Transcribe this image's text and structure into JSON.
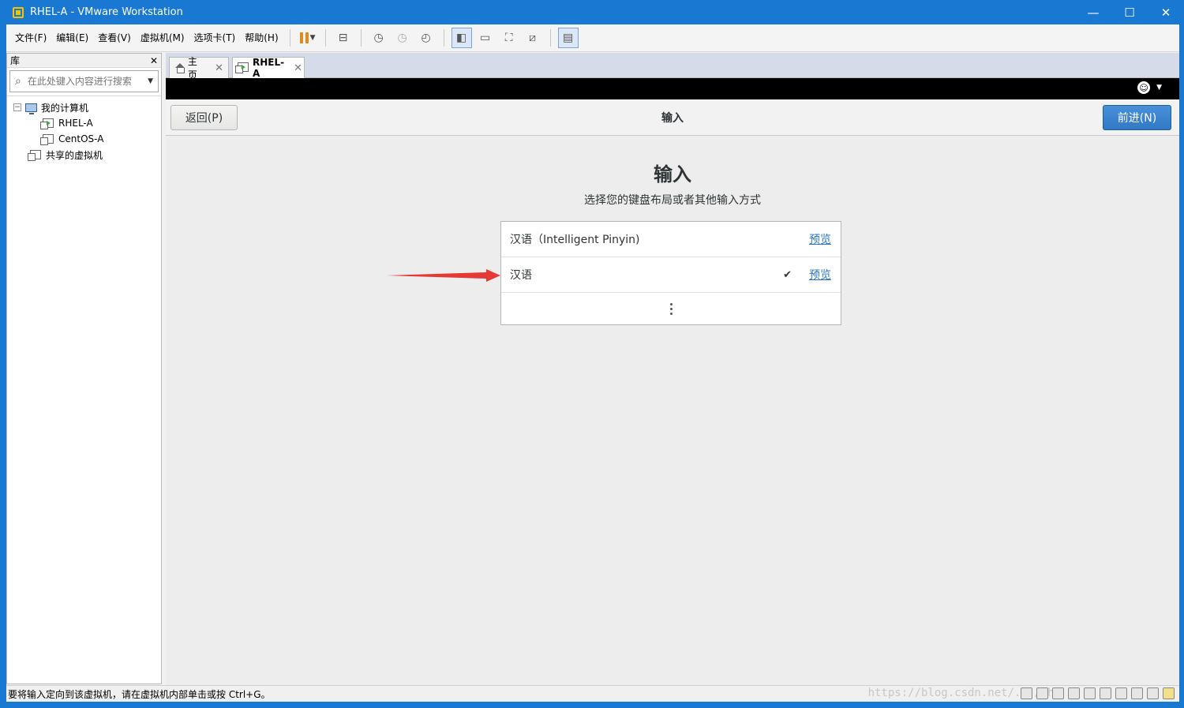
{
  "window": {
    "title": "RHEL-A - VMware Workstation",
    "minimize": "—",
    "maximize": "☐",
    "close": "✕"
  },
  "menu": {
    "items": [
      "文件(F)",
      "编辑(E)",
      "查看(V)",
      "虚拟机(M)",
      "选项卡(T)",
      "帮助(H)"
    ]
  },
  "library": {
    "title": "库",
    "close": "✕",
    "search_placeholder": "在此处键入内容进行搜索",
    "tree": {
      "root": "我的计算机",
      "vm1": "RHEL-A",
      "vm2": "CentOS-A",
      "shared": "共享的虚拟机"
    }
  },
  "tabs": [
    {
      "label": "主页",
      "close": "✕"
    },
    {
      "label": "RHEL-A",
      "close": "✕"
    }
  ],
  "installer": {
    "back_button": "返回(P)",
    "next_button": "前进(N)",
    "header_title": "输入",
    "heading": "输入",
    "subtitle": "选择您的键盘布局或者其他输入方式",
    "options": [
      {
        "label": "汉语（Intelligent Pinyin)",
        "preview": "预览",
        "checked": false
      },
      {
        "label": "汉语",
        "preview": "预览",
        "checked": true
      }
    ],
    "check_mark": "✔"
  },
  "statusbar": {
    "message": "要将输入定向到该虚拟机，请在虚拟机内部单击或按 Ctrl+G。",
    "watermark": "https://blog.csdn.net/.../ghy"
  },
  "colors": {
    "titlebar": "#1979d2",
    "next_button": "#3178c6",
    "link": "#2a76c6",
    "arrow": "#e53935"
  }
}
